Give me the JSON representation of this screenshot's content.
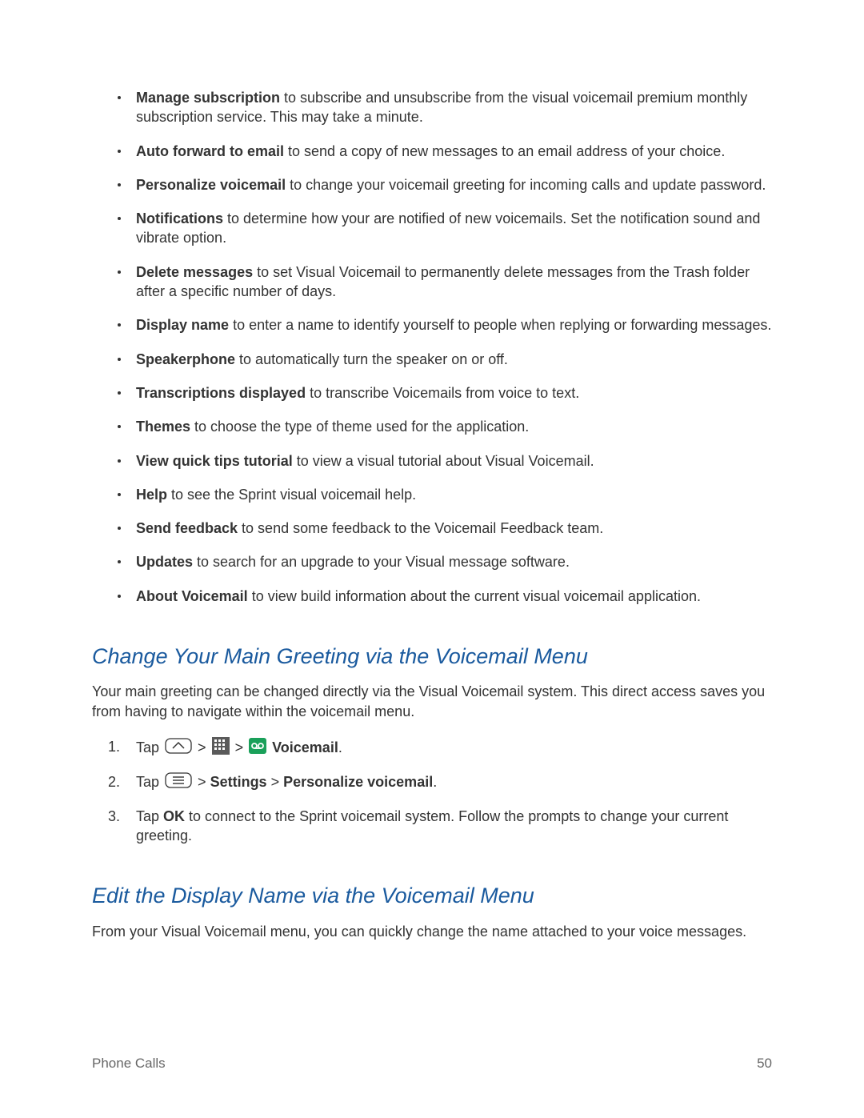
{
  "bullets": [
    {
      "term": "Manage subscription",
      "text": " to subscribe and unsubscribe from the visual voicemail premium monthly subscription service. This may take a minute."
    },
    {
      "term": "Auto forward to email",
      "text": " to send a copy of new messages to an email address of your choice."
    },
    {
      "term": "Personalize voicemail",
      "text": " to change your voicemail greeting for incoming calls and update password."
    },
    {
      "term": "Notifications",
      "text": " to determine how your are notified of new voicemails. Set the notification sound and vibrate option."
    },
    {
      "term": "Delete messages",
      "text": " to set Visual Voicemail to permanently delete messages from the Trash folder after a specific number of days."
    },
    {
      "term": "Display name",
      "text": " to enter a name to identify yourself to people when replying or forwarding messages."
    },
    {
      "term": "Speakerphone",
      "text": " to automatically turn the speaker on or off."
    },
    {
      "term": "Transcriptions displayed",
      "text": " to transcribe Voicemails from voice to text."
    },
    {
      "term": "Themes",
      "text": " to choose the type of theme used for the application."
    },
    {
      "term": "View quick tips tutorial",
      "text": " to view a visual tutorial about Visual Voicemail."
    },
    {
      "term": "Help",
      "text": " to see the Sprint visual voicemail help."
    },
    {
      "term": "Send feedback",
      "text": " to send some feedback to the Voicemail Feedback team."
    },
    {
      "term": "Updates",
      "text": " to search for an upgrade to your Visual message software."
    },
    {
      "term": "About Voicemail",
      "text": " to view build information about the current visual voicemail application."
    }
  ],
  "section1": {
    "heading": "Change Your Main Greeting via the Voicemail Menu",
    "lead": "Your main greeting can be changed directly via the Visual Voicemail system. This direct access saves you from having to navigate within the voicemail menu.",
    "step1_tap": "Tap ",
    "step1_end": "Voicemail",
    "step1_period": ".",
    "step2_tap": "Tap ",
    "step2_settings": "Settings",
    "step2_personalize": "Personalize voicemail",
    "step2_period": ".",
    "step3_a": "Tap ",
    "step3_ok": "OK",
    "step3_b": " to connect to the Sprint voicemail system. Follow the prompts to change your current greeting.",
    "gt": " > "
  },
  "section2": {
    "heading": "Edit the Display Name via the Voicemail Menu",
    "lead": "From your Visual Voicemail menu, you can quickly change the name attached to your voice messages."
  },
  "footer": {
    "left": "Phone Calls",
    "right": "50"
  }
}
